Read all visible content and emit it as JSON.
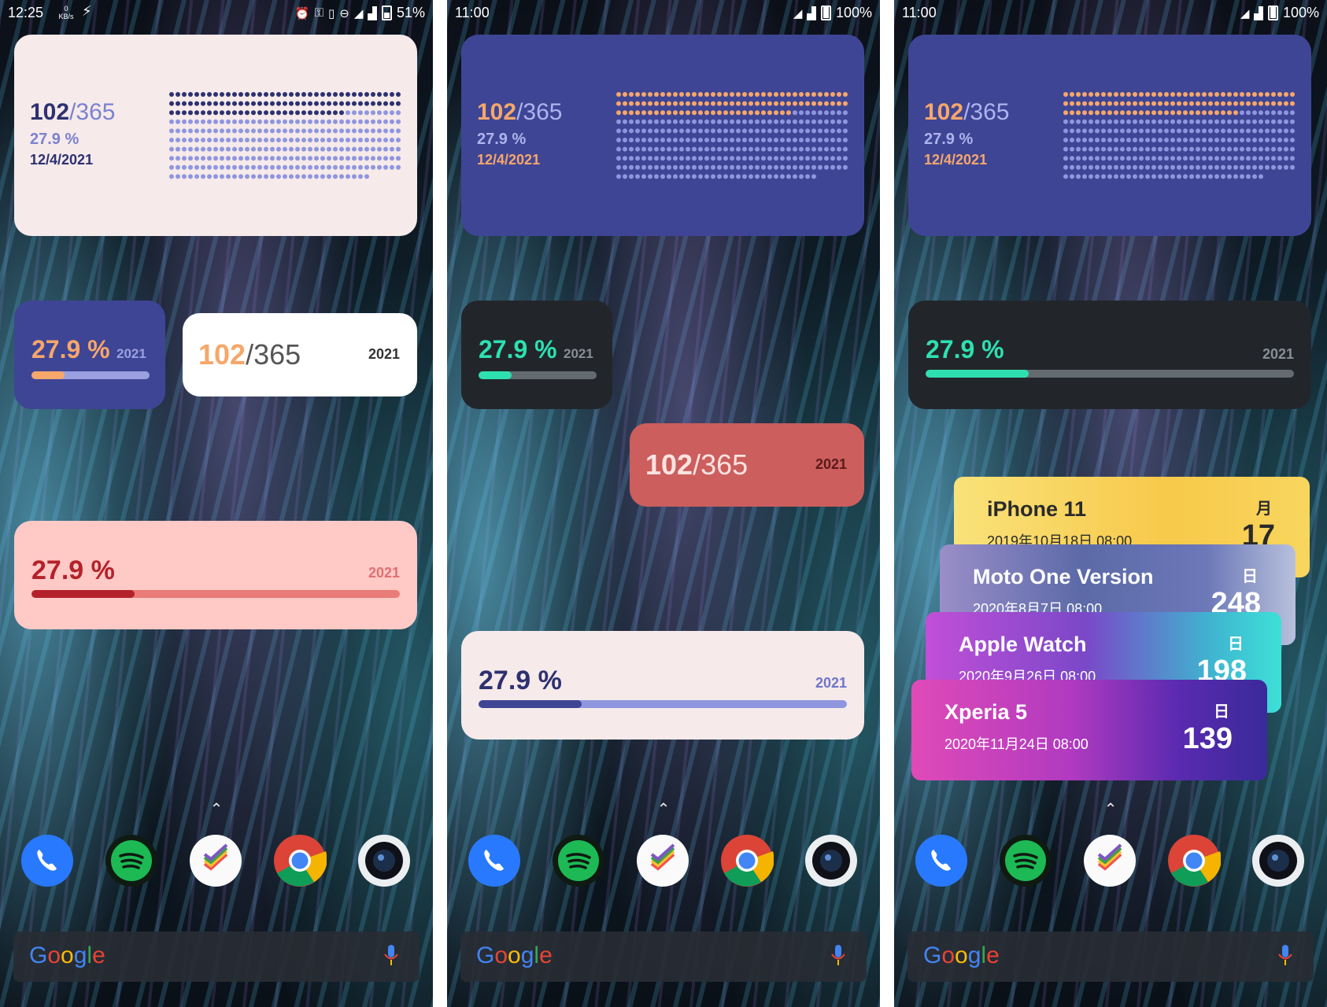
{
  "screens": [
    {
      "status": {
        "time": "12:25",
        "speed": "0 KB/s",
        "battery": "51%"
      },
      "big": {
        "day": "102",
        "total": "/365",
        "percent": "27.9 %",
        "date": "12/4/2021"
      },
      "small_progress": {
        "percent": "27.9 %",
        "year": "2021"
      },
      "counter": {
        "day": "102",
        "total": "/365",
        "year": "2021"
      },
      "wide_progress": {
        "percent": "27.9 %",
        "year": "2021"
      },
      "search_logo": "Google"
    },
    {
      "status": {
        "time": "11:00",
        "battery": "100%"
      },
      "big": {
        "day": "102",
        "total": "/365",
        "percent": "27.9 %",
        "date": "12/4/2021"
      },
      "small_progress": {
        "percent": "27.9 %",
        "year": "2021"
      },
      "counter": {
        "day": "102",
        "total": "/365",
        "year": "2021"
      },
      "wide_progress": {
        "percent": "27.9 %",
        "year": "2021"
      },
      "search_logo": "Google"
    },
    {
      "status": {
        "time": "11:00",
        "battery": "100%"
      },
      "big": {
        "day": "102",
        "total": "/365",
        "percent": "27.9 %",
        "date": "12/4/2021"
      },
      "wide_progress": {
        "percent": "27.9 %",
        "year": "2021"
      },
      "countdown_cards": [
        {
          "name": "iPhone 11",
          "date": "2019年10月18日 08:00",
          "unit": "月",
          "value": "17"
        },
        {
          "name": "Moto One Version",
          "date": "2020年8月7日 08:00",
          "unit": "日",
          "value": "248"
        },
        {
          "name": "Apple Watch",
          "date": "2020年9月26日 08:00",
          "unit": "日",
          "value": "198"
        },
        {
          "name": "Xperia 5",
          "date": "2020年11月24日 08:00",
          "unit": "日",
          "value": "139"
        }
      ],
      "search_logo": "Google"
    }
  ],
  "progress_fraction": 0.279,
  "days_elapsed": 102,
  "days_total": 365,
  "dock_apps": [
    "phone-icon",
    "spotify-icon",
    "tasks-icon",
    "chrome-icon",
    "camera-icon"
  ],
  "colors": {
    "indigo": "#3f4595",
    "cream": "#f6eaea",
    "peach": "#f6a76a",
    "teal": "#2ee0b0",
    "dark": "#22262b",
    "coral": "#cc5e5e",
    "pink": "#ffc9c6",
    "crimson": "#b3222b"
  }
}
